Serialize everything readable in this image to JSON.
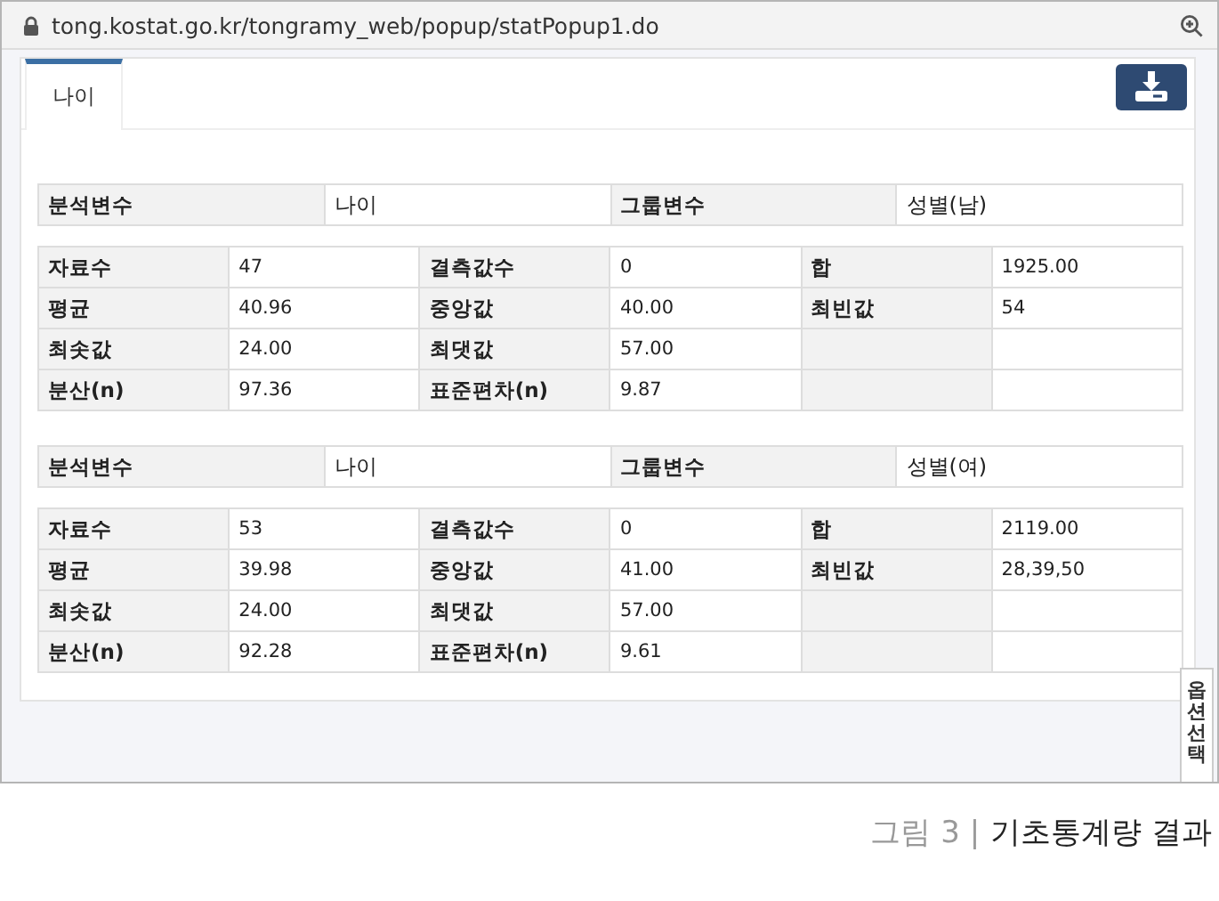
{
  "address_bar": {
    "url": "tong.kostat.go.kr/tongramy_web/popup/statPopup1.do"
  },
  "tabs": [
    {
      "label": "나이",
      "selected": true
    }
  ],
  "groups": [
    {
      "info": [
        {
          "label": "분석변수",
          "value": "나이"
        },
        {
          "label": "그룹변수",
          "value": "성별(남)"
        }
      ],
      "stats": [
        [
          {
            "label": "자료수",
            "value": "47"
          },
          {
            "label": "결측값수",
            "value": "0"
          },
          {
            "label": "합",
            "value": "1925.00"
          }
        ],
        [
          {
            "label": "평균",
            "value": "40.96"
          },
          {
            "label": "중앙값",
            "value": "40.00"
          },
          {
            "label": "최빈값",
            "value": "54"
          }
        ],
        [
          {
            "label": "최솟값",
            "value": "24.00"
          },
          {
            "label": "최댓값",
            "value": "57.00"
          }
        ],
        [
          {
            "label": "분산(n)",
            "value": "97.36"
          },
          {
            "label": "표준편차(n)",
            "value": "9.87"
          }
        ]
      ]
    },
    {
      "info": [
        {
          "label": "분석변수",
          "value": "나이"
        },
        {
          "label": "그룹변수",
          "value": "성별(여)"
        }
      ],
      "stats": [
        [
          {
            "label": "자료수",
            "value": "53"
          },
          {
            "label": "결측값수",
            "value": "0"
          },
          {
            "label": "합",
            "value": "2119.00"
          }
        ],
        [
          {
            "label": "평균",
            "value": "39.98"
          },
          {
            "label": "중앙값",
            "value": "41.00"
          },
          {
            "label": "최빈값",
            "value": "28,39,50"
          }
        ],
        [
          {
            "label": "최솟값",
            "value": "24.00"
          },
          {
            "label": "최댓값",
            "value": "57.00"
          }
        ],
        [
          {
            "label": "분산(n)",
            "value": "92.28"
          },
          {
            "label": "표준편차(n)",
            "value": "9.61"
          }
        ]
      ]
    }
  ],
  "side_tab": {
    "label": "옵션선택"
  },
  "caption": {
    "figure": "그림 3 |",
    "title": "기초통계량 결과"
  }
}
